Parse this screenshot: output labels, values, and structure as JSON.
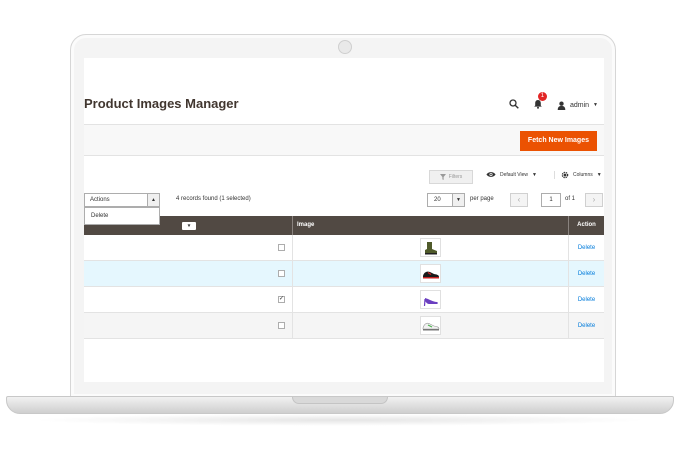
{
  "page": {
    "title": "Product Images Manager"
  },
  "header": {
    "notification_count": "1",
    "user_label": "admin"
  },
  "toolbar": {
    "fetch_label": "Fetch New Images"
  },
  "controls": {
    "filters_label": "Filters",
    "view_label": "Default View",
    "columns_label": "Columns",
    "actions_label": "Actions",
    "actions_options": [
      "Delete"
    ],
    "records_text": "4 records found (1 selected)",
    "per_page_value": "20",
    "per_page_label": "per page",
    "current_page": "1",
    "page_of_text": "of 1"
  },
  "grid": {
    "columns": [
      "",
      "Image",
      "Action"
    ],
    "rows": [
      {
        "checked": false,
        "image": "green high-top boot",
        "action": "Delete"
      },
      {
        "checked": false,
        "image": "black and red sneaker",
        "action": "Delete"
      },
      {
        "checked": true,
        "image": "purple high-heel shoe",
        "action": "Delete"
      },
      {
        "checked": false,
        "image": "white and green sneaker",
        "action": "Delete"
      }
    ]
  },
  "colors": {
    "accent": "#eb5202",
    "grid_header": "#514943",
    "link": "#007bdb",
    "badge": "#e22626",
    "row_highlight": "#e5f7fe"
  }
}
